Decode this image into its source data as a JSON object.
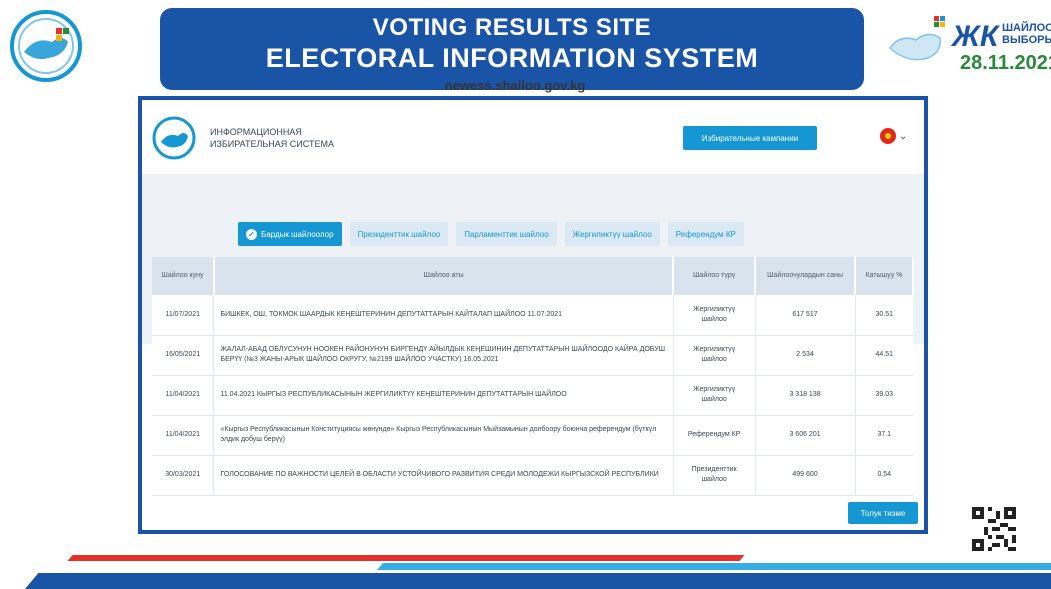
{
  "slide": {
    "title_line1": "VOTING RESULTS SITE",
    "title_line2": "Electoral information system",
    "url": "newess.shailoo.gov.kg",
    "right_logo": {
      "letters": "ЖК",
      "line1": "ШАЙЛОО",
      "line2": "ВЫБОРЫ",
      "date": "28.11.2021"
    }
  },
  "app": {
    "title_line1": "ИНФОРМАЦИОННАЯ",
    "title_line2": "ИЗБИРАТЕЛЬНАЯ СИСТЕМА",
    "campaigns_button": "Избирательные кампании",
    "language_icon": "kyrgyz-flag-icon",
    "tabs": [
      {
        "label": "Бардык шайлоолор",
        "active": true
      },
      {
        "label": "Президенттик шайлоо",
        "active": false
      },
      {
        "label": "Парламенттик шайлоо",
        "active": false
      },
      {
        "label": "Жергиликтүү шайлоо",
        "active": false
      },
      {
        "label": "Референдум КР",
        "active": false
      }
    ],
    "table": {
      "headers": [
        "Шайлоо куну",
        "Шайлоо аты",
        "Шайлоо түрү",
        "Шайлоочулардын саны",
        "Катышуу %"
      ],
      "rows": [
        {
          "date": "11/07/2021",
          "name": "БИШКЕК, ОШ, ТОКМОК ШААРДЫК КЕҢЕШТЕРИНИН ДЕПУТАТТАРЫН КАЙТАЛАП ШАЙЛОО 11.07.2021",
          "type": "Жергиликтүү шайлоо",
          "voters": "617 517",
          "turnout": "30.51"
        },
        {
          "date": "16/05/2021",
          "name": "ЖАЛАЛ-АБАД ОБЛУСУНУН НООКЕН РАЙОНУНУН БИРГЕНДҮ АЙЫЛДЫК КЕҢЕШИНИН ДЕПУТАТТАРЫН ШАЙЛООДО КАЙРА ДОБУШ БЕРҮҮ (№3 ЖАНЫ-АРЫК ШАЙЛОО ОКРУГУ, №2199 ШАЙЛОО УЧАСТКУ) 16.05.2021",
          "type": "Жергиликтүү шайлоо",
          "voters": "2 534",
          "turnout": "44.51"
        },
        {
          "date": "11/04/2021",
          "name": "11.04.2021 КЫРГЫЗ РЕСПУБЛИКАСЫНЫН ЖЕРГИЛИКТҮҮ КЕҢЕШТЕРИНИН ДЕПУТАТТАРЫН ШАЙЛОО",
          "type": "Жергиликтүү шайлоо",
          "voters": "3 318 138",
          "turnout": "39.03"
        },
        {
          "date": "11/04/2021",
          "name": "«Кыргыз Республикасынын Конституциясы жөнүндө» Кыргыз Республикасынын Мыйзамынын долбоору боюнча референдум (бүткүл элдик добуш берүү)",
          "type": "Референдум КР",
          "voters": "3 606 201",
          "turnout": "37.1"
        },
        {
          "date": "30/03/2021",
          "name": "ГОЛОСОВАНИЕ ПО ВАЖНОСТИ ЦЕЛЕЙ В ОБЛАСТИ УСТОЙЧИВОГО РАЗВИТИЯ СРЕДИ МОЛОДЕЖИ КЫРГЫЗСКОЙ РЕСПУБЛИКИ",
          "type": "Президенттик шайлоо",
          "voters": "499 600",
          "turnout": "0.54"
        }
      ]
    },
    "info_button": "Толук тизме",
    "colors": {
      "brand_blue": "#1a54a7",
      "accent_blue": "#1597d4",
      "tab_bg": "#dbe9f5"
    }
  }
}
